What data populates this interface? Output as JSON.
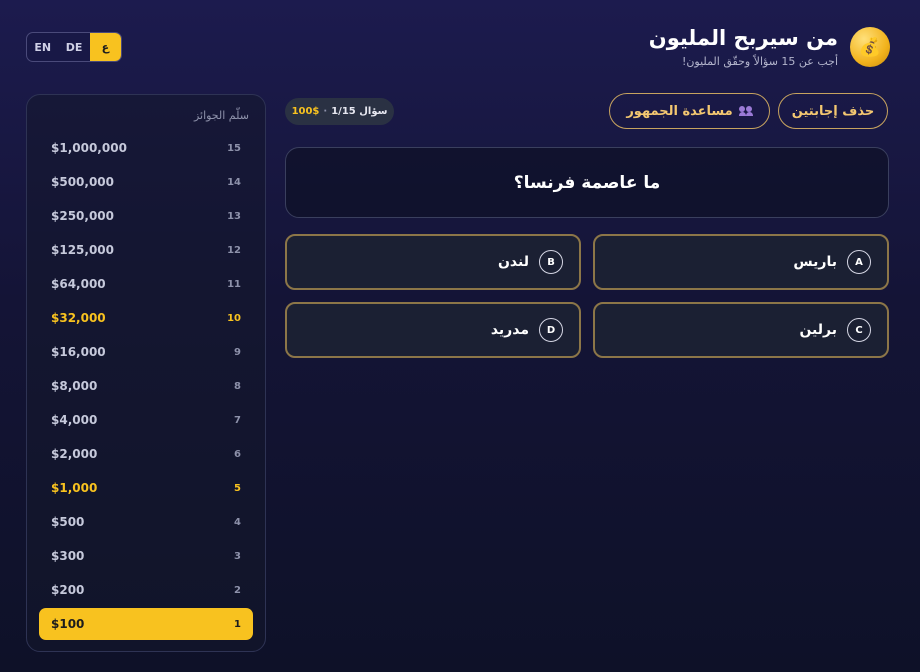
{
  "header": {
    "title": "من سيربح المليون",
    "subtitle": "أجب عن 15 سؤالاً وحقّق المليون!",
    "logo_icon": "money-bag-icon"
  },
  "language": {
    "options": [
      "ع",
      "DE",
      "EN"
    ],
    "active": "ع"
  },
  "ladder": {
    "title": "سلّم الجوائز",
    "levels": [
      {
        "num": "15",
        "amount": "$1,000,000"
      },
      {
        "num": "14",
        "amount": "$500,000"
      },
      {
        "num": "13",
        "amount": "$250,000"
      },
      {
        "num": "12",
        "amount": "$125,000"
      },
      {
        "num": "11",
        "amount": "$64,000"
      },
      {
        "num": "10",
        "amount": "$32,000"
      },
      {
        "num": "9",
        "amount": "$16,000"
      },
      {
        "num": "8",
        "amount": "$8,000"
      },
      {
        "num": "7",
        "amount": "$4,000"
      },
      {
        "num": "6",
        "amount": "$2,000"
      },
      {
        "num": "5",
        "amount": "$1,000"
      },
      {
        "num": "4",
        "amount": "$500"
      },
      {
        "num": "3",
        "amount": "$300"
      },
      {
        "num": "2",
        "amount": "$200"
      },
      {
        "num": "1",
        "amount": "$100"
      }
    ],
    "safe_levels": [
      "10",
      "5"
    ],
    "current_level": "1"
  },
  "lifelines": {
    "fifty_fifty": "حذف إجابتين",
    "audience": "مساعدة الجمهور",
    "audience_icon": "people-icon"
  },
  "status": {
    "question_label": "سؤال 1/15",
    "separator": "·",
    "prize": "100$"
  },
  "question": {
    "text": "ما عاصمة فرنسا؟"
  },
  "answers": [
    {
      "letter": "A",
      "text": "باريس"
    },
    {
      "letter": "B",
      "text": "لندن"
    },
    {
      "letter": "C",
      "text": "برلين"
    },
    {
      "letter": "D",
      "text": "مدريد"
    }
  ],
  "colors": {
    "accent": "#f8c21f",
    "answer_border": "#8c7648",
    "lifeline_border": "#c7a35f",
    "background": "#141436"
  }
}
